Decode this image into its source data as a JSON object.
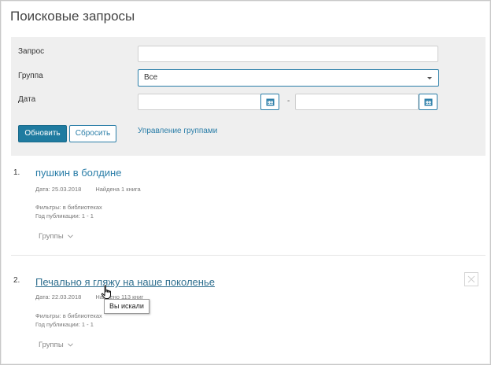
{
  "page": {
    "title": "Поисковые запросы"
  },
  "form": {
    "query_label": "Запрос",
    "query_value": "",
    "group_label": "Группа",
    "group_selected": "Все",
    "date_label": "Дата",
    "date_from_value": "",
    "date_to_value": "",
    "date_separator": "-",
    "refresh_label": "Обновить",
    "reset_label": "Сбросить",
    "manage_groups_link": "Управление группами"
  },
  "results": [
    {
      "number": "1.",
      "title": "пушкин в болдине",
      "date": "Дата: 25.03.2018",
      "found": "Найдена 1 книга",
      "filters_label": "Фильтры:",
      "filters_value": "в библиотеках",
      "year_label": "Год публикации:",
      "year_value": "1 - 1",
      "groups_label": "Группы"
    },
    {
      "number": "2.",
      "title": "Печально я гляжу на наше поколенье",
      "date": "Дата: 22.03.2018",
      "found": "Найдено 113 книг",
      "filters_label": "Фильтры:",
      "filters_value": "в библиотеках",
      "year_label": "Год публикации:",
      "year_value": "1 - 1",
      "groups_label": "Группы"
    }
  ],
  "tooltip": {
    "text": "Вы искали"
  },
  "colors": {
    "accent": "#1f7ba0",
    "link": "#2b7ea8",
    "panel": "#efefef"
  },
  "icons": [
    "calendar-icon",
    "chevron-down-icon",
    "close-icon",
    "hand-cursor-icon"
  ]
}
